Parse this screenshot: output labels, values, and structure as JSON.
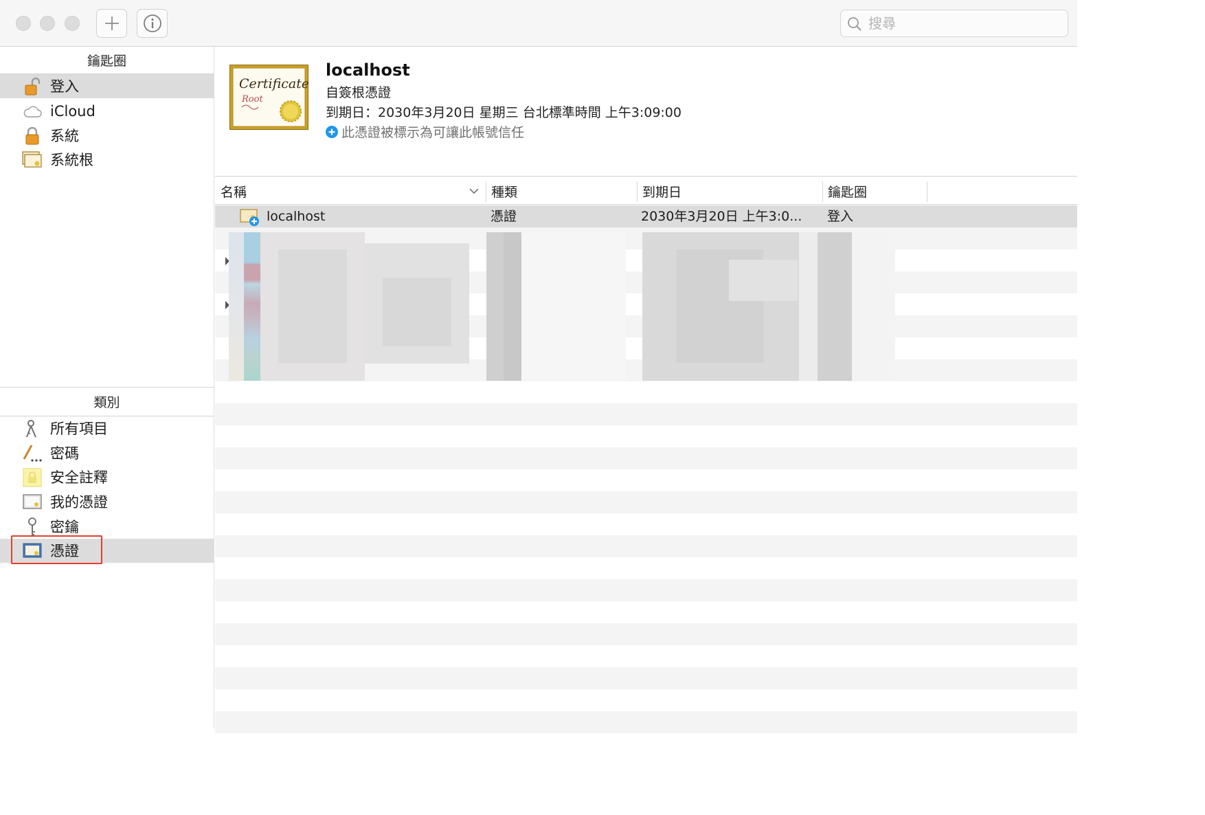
{
  "window": {
    "toolbar": {
      "add_button": "add",
      "info_button": "info",
      "search": {
        "placeholder": "搜尋",
        "value": ""
      }
    }
  },
  "sidebar": {
    "keychains_header": "鑰匙圈",
    "keychains": [
      {
        "label": "登入",
        "icon": "lock-open-icon",
        "selected": true
      },
      {
        "label": "iCloud",
        "icon": "cloud-icon",
        "selected": false
      },
      {
        "label": "系統",
        "icon": "lock-icon",
        "selected": false
      },
      {
        "label": "系統根",
        "icon": "certificate-stack-icon",
        "selected": false
      }
    ],
    "categories_header": "類別",
    "categories": [
      {
        "label": "所有項目",
        "icon": "keys-icon",
        "selected": false
      },
      {
        "label": "密碼",
        "icon": "pencil-icon",
        "selected": false
      },
      {
        "label": "安全註釋",
        "icon": "note-lock-icon",
        "selected": false
      },
      {
        "label": "我的憑證",
        "icon": "my-certificate-icon",
        "selected": false
      },
      {
        "label": "密鑰",
        "icon": "key-icon",
        "selected": false
      },
      {
        "label": "憑證",
        "icon": "certificate-icon",
        "selected": true
      }
    ]
  },
  "detail": {
    "badge_text_1": "Certificate",
    "badge_text_2": "Root",
    "title": "localhost",
    "subtitle": "自簽根憑證",
    "expiry": "到期日：2030年3月20日 星期三 台北標準時間 上午3:09:00",
    "trust_note": "此憑證被標示為可讓此帳號信任"
  },
  "table": {
    "columns": [
      "名稱",
      "種類",
      "到期日",
      "鑰匙圈"
    ],
    "rows": [
      {
        "name": "localhost",
        "kind": "憑證",
        "expires": "2030年3月20日 上午3:0...",
        "keychain": "登入",
        "selected": true
      }
    ]
  },
  "colors": {
    "selection": "#dcdcdc",
    "accent_blue": "#1e97ec",
    "highlight_red": "#e0412e",
    "cert_gold": "#c9a227"
  }
}
